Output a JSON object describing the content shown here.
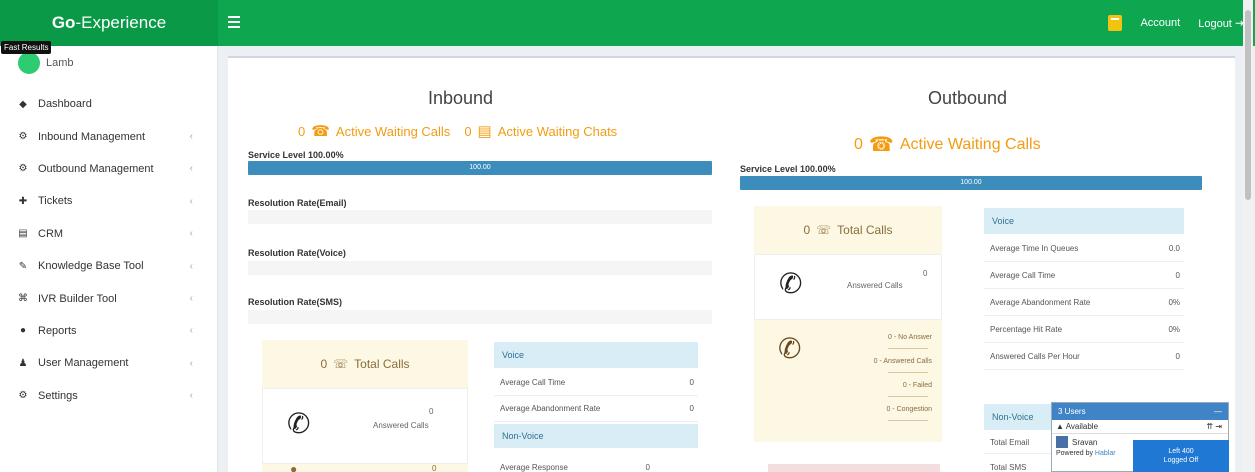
{
  "header": {
    "brand_bold": "Go",
    "brand_rest": "-Experience",
    "account_label": "Account",
    "logout_label": "Logout"
  },
  "tooltip": "Fast Results",
  "sidebar": {
    "user_name": "Lamb",
    "items": [
      {
        "label": "Dashboard",
        "icon": "dashboard-icon",
        "glyph": "◆",
        "chevron": false
      },
      {
        "label": "Inbound Management",
        "icon": "inbound-icon",
        "glyph": "⚙",
        "chevron": true
      },
      {
        "label": "Outbound Management",
        "icon": "outbound-icon",
        "glyph": "⚙",
        "chevron": true
      },
      {
        "label": "Tickets",
        "icon": "ticket-icon",
        "glyph": "✚",
        "chevron": true
      },
      {
        "label": "CRM",
        "icon": "crm-icon",
        "glyph": "▤",
        "chevron": true
      },
      {
        "label": "Knowledge Base Tool",
        "icon": "book-icon",
        "glyph": "✎",
        "chevron": true
      },
      {
        "label": "IVR Builder Tool",
        "icon": "ivr-icon",
        "glyph": "⌘",
        "chevron": true
      },
      {
        "label": "Reports",
        "icon": "reports-icon",
        "glyph": "●",
        "chevron": true
      },
      {
        "label": "User Management",
        "icon": "users-icon",
        "glyph": "♟",
        "chevron": true
      },
      {
        "label": "Settings",
        "icon": "settings-icon",
        "glyph": "⚙",
        "chevron": true
      }
    ]
  },
  "inbound": {
    "title": "Inbound",
    "waiting_calls_count": "0",
    "waiting_calls_label": "Active Waiting Calls",
    "waiting_chats_count": "0",
    "waiting_chats_label": "Active Waiting Chats",
    "service_level_label": "Service Level 100.00%",
    "service_level_pct": 100,
    "service_level_bar_text": "100.00",
    "resolution_email": "Resolution Rate(Email)",
    "resolution_voice": "Resolution Rate(Voice)",
    "resolution_sms": "Resolution Rate(SMS)",
    "total_calls_count": "0",
    "total_calls_label": "Total Calls",
    "answered_count": "0",
    "answered_label": "Answered Calls",
    "voice_head": "Voice",
    "avg_call_time_label": "Average Call Time",
    "avg_call_time_val": "0",
    "avg_abandon_label": "Average Abandonment Rate",
    "avg_abandon_val": "0",
    "non_voice_head": "Non-Voice",
    "avg_response_label": "Average Response",
    "avg_response_val": "0",
    "lower_count": "0"
  },
  "outbound": {
    "title": "Outbound",
    "waiting_calls_count": "0",
    "waiting_calls_label": "Active Waiting Calls",
    "service_level_label": "Service Level 100.00%",
    "service_level_pct": 100,
    "service_level_bar_text": "100.00",
    "total_calls_count": "0",
    "total_calls_label": "Total Calls",
    "answered_count": "0",
    "answered_label": "Answered Calls",
    "status_list": [
      "0 - No Answer",
      "0 - Answered Calls",
      "0 - Failed",
      "0 - Congestion"
    ],
    "voice_head": "Voice",
    "stats": [
      {
        "label": "Average Time In Queues",
        "value": "0.0"
      },
      {
        "label": "Average Call Time",
        "value": "0"
      },
      {
        "label": "Average Abandonment Rate",
        "value": "0%"
      },
      {
        "label": "Percentage Hit Rate",
        "value": "0%"
      },
      {
        "label": "Answered Calls Per Hour",
        "value": "0"
      }
    ],
    "non_voice_head": "Non-Voice",
    "total_email_label": "Total Email",
    "total_sms_label": "Total SMS"
  },
  "chat_widget": {
    "title": "3 Users",
    "status": "Available",
    "contact": "Sravan",
    "powered_prefix": "Powered by",
    "powered_link": "Hablar",
    "panel_line1": "Left 400",
    "panel_line2": "Logged Off"
  }
}
